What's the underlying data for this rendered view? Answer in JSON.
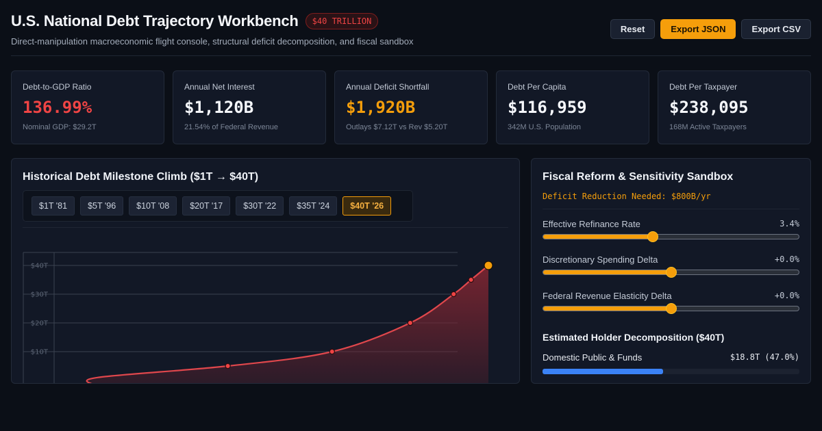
{
  "header": {
    "title": "U.S. National Debt Trajectory Workbench",
    "badge": "$40 TRILLION",
    "subtitle": "Direct-manipulation macroeconomic flight console, structural deficit decomposition, and fiscal sandbox",
    "buttons": {
      "reset": "Reset",
      "export_json": "Export JSON",
      "export_csv": "Export CSV"
    }
  },
  "kpis": [
    {
      "label": "Debt-to-GDP Ratio",
      "value": "136.99%",
      "sub": "Nominal GDP: $29.2T"
    },
    {
      "label": "Annual Net Interest",
      "value": "$1,120B",
      "sub": "21.54% of Federal Revenue"
    },
    {
      "label": "Annual Deficit Shortfall",
      "value": "$1,920B",
      "sub": "Outlays $7.12T vs Rev $5.20T"
    },
    {
      "label": "Debt Per Capita",
      "value": "$116,959",
      "sub": "342M U.S. Population"
    },
    {
      "label": "Debt Per Taxpayer",
      "value": "$238,095",
      "sub": "168M Active Taxpayers"
    }
  ],
  "chart_panel": {
    "title": "Historical Debt Milestone Climb ($1T → $40T)",
    "milestones": [
      "$1T '81",
      "$5T '96",
      "$10T '08",
      "$20T '17",
      "$30T '22",
      "$35T '24",
      "$40T '26"
    ],
    "active_milestone": "$40T '26"
  },
  "chart_data": {
    "type": "area",
    "y_tick_labels": [
      "$10T",
      "$20T",
      "$30T",
      "$40T"
    ],
    "yticks": [
      10,
      20,
      30,
      40
    ],
    "ylim": [
      0,
      45
    ],
    "x": [
      1981,
      1996,
      2008,
      2017,
      2022,
      2024,
      2026
    ],
    "xlim": [
      1976,
      2026
    ],
    "series": [
      {
        "values": [
          1,
          5,
          10,
          20,
          30,
          35,
          40
        ]
      }
    ],
    "colors": {
      "line": "#e0474c",
      "area_top": "#7a2531",
      "point": "#ef4444",
      "highlight": "#f59e0b"
    },
    "grid": true
  },
  "sandbox": {
    "title": "Fiscal Reform & Sensitivity Sandbox",
    "reduction_text": "Deficit Reduction Needed: $800B/yr",
    "sliders": [
      {
        "label": "Effective Refinance Rate",
        "value": "3.4%",
        "level": 0.43
      },
      {
        "label": "Discretionary Spending Delta",
        "value": "+0.0%",
        "level": 0.5
      },
      {
        "label": "Federal Revenue Elasticity Delta",
        "value": "+0.0%",
        "level": 0.5
      }
    ],
    "holders_title": "Estimated Holder Decomposition ($40T)",
    "holders": [
      {
        "label": "Domestic Public & Funds",
        "value": "$18.8T (47.0%)",
        "share": 0.47
      }
    ]
  },
  "colors": {
    "accent": "#f59e0b",
    "danger": "#ef4444",
    "holder_bar": "#3b82f6"
  }
}
